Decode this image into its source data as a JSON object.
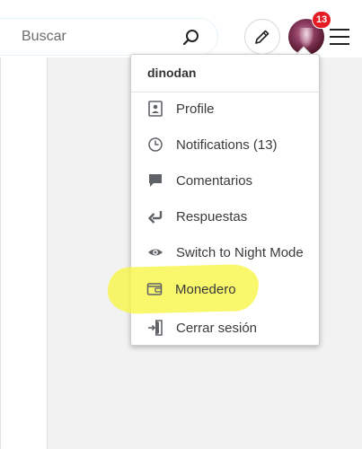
{
  "search": {
    "placeholder": "Buscar"
  },
  "header": {
    "notification_count": "13",
    "avatar_alt": "user avatar"
  },
  "dropdown": {
    "username": "dinodan",
    "items": [
      {
        "label": "Profile",
        "icon": "profile-card-icon"
      },
      {
        "label": "Notifications (13)",
        "icon": "clock-icon"
      },
      {
        "label": "Comentarios",
        "icon": "comment-bubble-icon"
      },
      {
        "label": "Respuestas",
        "icon": "reply-arrow-icon"
      },
      {
        "label": "Switch to Night Mode",
        "icon": "eye-icon"
      },
      {
        "label": "Monedero",
        "icon": "wallet-icon"
      },
      {
        "label": "Cerrar sesión",
        "icon": "logout-icon"
      }
    ]
  },
  "colors": {
    "badge": "#e41b23",
    "icon": "#5f6368",
    "highlight": "#f7f542"
  }
}
